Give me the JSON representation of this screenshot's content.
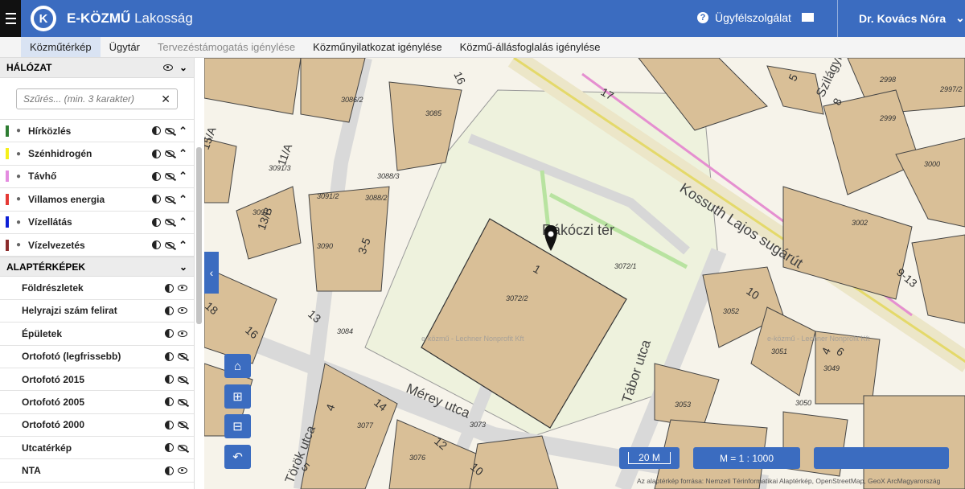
{
  "header": {
    "brand_bold": "E-KÖZMŰ",
    "brand_sub": "Lakosság",
    "logo_letter": "K",
    "help_label": "Ügyfélszolgálat",
    "user_name": "Dr. Kovács Nóra",
    "bg_color": "#3b6cc0"
  },
  "tabs": [
    {
      "label": "Közműtérkép"
    },
    {
      "label": "Ügytár"
    },
    {
      "label": "Tervezéstámogatás igénylése"
    },
    {
      "label": "Közműnyilatkozat igénylése"
    },
    {
      "label": "Közmű-állásfoglalás igénylése"
    }
  ],
  "sidebar": {
    "network_title": "HÁLÓZAT",
    "filter_placeholder": "Szűrés... (min. 3 karakter)",
    "layers": [
      {
        "label": "Hírközlés",
        "color": "#2e7d32"
      },
      {
        "label": "Szénhidrogén",
        "color": "#f5f01a"
      },
      {
        "label": "Távhő",
        "color": "#e48ce0"
      },
      {
        "label": "Villamos energia",
        "color": "#e53935"
      },
      {
        "label": "Vízellátás",
        "color": "#0d1fd6"
      },
      {
        "label": "Vízelvezetés",
        "color": "#8b2b2b"
      }
    ],
    "base_title": "ALAPTÉRKÉPEK",
    "base_layers": [
      {
        "label": "Földrészletek",
        "visible": true
      },
      {
        "label": "Helyrajzi szám felirat",
        "visible": true
      },
      {
        "label": "Épületek",
        "visible": true
      },
      {
        "label": "Ortofotó (legfrissebb)",
        "visible": false
      },
      {
        "label": "Ortofotó 2015",
        "visible": false
      },
      {
        "label": "Ortofotó 2005",
        "visible": false
      },
      {
        "label": "Ortofotó 2000",
        "visible": false
      },
      {
        "label": "Utcatérkép",
        "visible": false
      },
      {
        "label": "NTA",
        "visible": true
      }
    ]
  },
  "map": {
    "labels": {
      "place": "Rákóczi tér",
      "street1": "Kossuth Lajos sugárút",
      "street2": "Mérey utca",
      "street3": "Tábor utca",
      "street4": "Szilágyi",
      "street5": "Török utca"
    },
    "parcels": [
      "3086/2",
      "3085",
      "3091/3",
      "3088/3",
      "3091/2",
      "3088/2",
      "3091",
      "3090",
      "3084",
      "3072/2",
      "3072/1",
      "3002",
      "3000",
      "2999",
      "2998",
      "2997/2",
      "3052",
      "3051",
      "3049",
      "3050",
      "3053",
      "3077",
      "3076",
      "3073"
    ],
    "house_numbers": [
      "16",
      "15/A",
      "11/A",
      "13/B",
      "3-5",
      "17",
      "5",
      "8",
      "9-13",
      "10",
      "1",
      "18",
      "13",
      "16",
      "4",
      "14",
      "12",
      "10",
      "5",
      "6",
      "4"
    ],
    "watermark": "e-közmű - Lechner Nonprofit Kft"
  },
  "controls": {
    "scale_bar": "20 M",
    "scale_ratio": "M = 1 : 1000",
    "attribution": "Az alaptérkép forrása: Nemzeti Térinformatikai Alaptérkép, OpenStreetMap, GeoX ArcMagyarország"
  }
}
